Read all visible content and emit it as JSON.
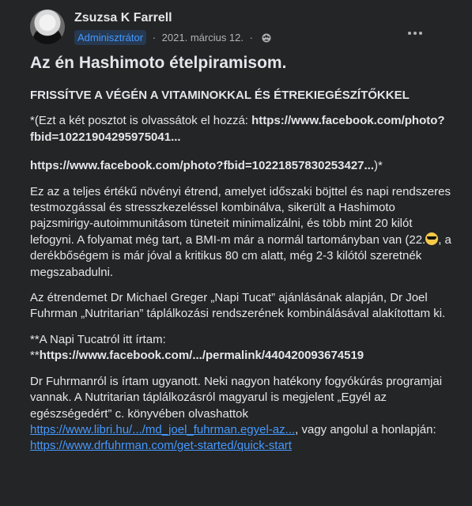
{
  "post": {
    "author": "Zsuzsa K Farrell",
    "role_badge": "Adminisztrátor",
    "separator": "·",
    "date": "2021. március 12.",
    "privacy_icon": "group-icon",
    "title": "Az én Hashimoto ételpiramisom.",
    "subtitle": "FRISSÍTVE A VÉGÉN A VITAMINOKKAL ÉS ÉTREKIEGÉSZÍTŐKKEL",
    "p1_prefix": "*(Ezt a két posztot is olvassátok el hozzá: ",
    "p1_link1": "https://www.facebook.com/photo?fbid=10221904295975041...",
    "p1_link2": "https://www.facebook.com/photo?fbid=10221857830253427...",
    "p1_suffix": ")*",
    "p2_a": "Ez az a teljes értékű növényi étrend, amelyet időszaki böjttel és napi rendszeres testmozgással és stresszkezeléssel kombinálva, sikerült a Hashimoto pajzsmirigy-autoimmunitásom tüneteit minimalizálni, és több mint 20 kilót lefogyni. A folyamat még tart, a BMI-m már a normál tartományban van (22.",
    "p2_emoji": "sunglasses-emoji",
    "p2_b": ", a derékbőségem is már jóval a kritikus 80 cm alatt, még 2-3 kilótól szeretnék megszabadulni.",
    "p3": "Az étrendemet Dr Michael Greger „Napi Tucat” ajánlásának alapján, Dr Joel Fuhrman „Nutritarian” táplálkozási rendszerének kombinálásával alakítottam ki.",
    "p4_prefix": "**A Napi Tucatról itt írtam: **",
    "p4_link": "https://www.facebook.com/.../permalink/440420093674519",
    "p5_a": "Dr Fuhrmanról is írtam ugyanott. Neki nagyon hatékony fogyókúrás programjai vannak. A Nutritarian táplálkozásról magyarul is megjelent „Egyél az egészségedért” c. könyvében olvashattok ",
    "p5_link1": "https://www.libri.hu/.../md_joel_fuhrman.egyel-az...",
    "p5_b": ", vagy angolul a honlapján: ",
    "p5_link2": "https://www.drfuhrman.com/get-started/quick-start"
  }
}
